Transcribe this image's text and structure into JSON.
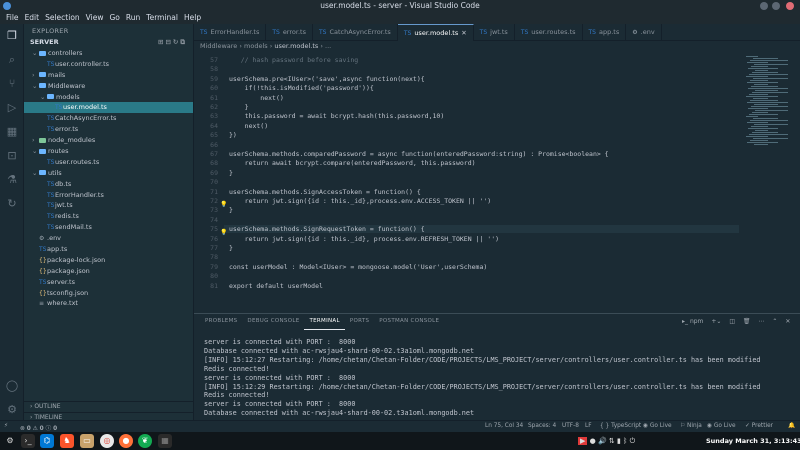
{
  "window": {
    "title": "user.model.ts - server - Visual Studio Code",
    "colors": {
      "close": "#e06c75",
      "min": "#5c6773",
      "max": "#5c6773",
      "accent": "#2a7a88"
    }
  },
  "menu": [
    "File",
    "Edit",
    "Selection",
    "View",
    "Go",
    "Run",
    "Terminal",
    "Help"
  ],
  "activity_icons": [
    "files-icon",
    "search-icon",
    "source-control-icon",
    "run-debug-icon",
    "extensions-icon",
    "remote-icon",
    "testing-icon",
    "docker-icon",
    "live-share-icon",
    "account-icon",
    "settings-icon"
  ],
  "explorer": {
    "header": "EXPLORER",
    "root": "SERVER",
    "tree": [
      {
        "label": "controllers",
        "type": "folder",
        "open": true
      },
      {
        "label": "user.controller.ts",
        "type": "ts"
      },
      {
        "label": "mails",
        "type": "folder",
        "open": false
      },
      {
        "label": "Middleware",
        "type": "folder",
        "open": true
      },
      {
        "label": "models",
        "type": "folder",
        "open": true
      },
      {
        "label": "user.model.ts",
        "type": "ts",
        "selected": true
      },
      {
        "label": "CatchAsyncError.ts",
        "type": "ts"
      },
      {
        "label": "error.ts",
        "type": "ts"
      },
      {
        "label": "node_modules",
        "type": "folder",
        "open": false
      },
      {
        "label": "routes",
        "type": "folder",
        "open": true
      },
      {
        "label": "user.routes.ts",
        "type": "ts"
      },
      {
        "label": "utils",
        "type": "folder",
        "open": true
      },
      {
        "label": "db.ts",
        "type": "ts"
      },
      {
        "label": "ErrorHandler.ts",
        "type": "ts"
      },
      {
        "label": "jwt.ts",
        "type": "ts"
      },
      {
        "label": "redis.ts",
        "type": "ts"
      },
      {
        "label": "sendMail.ts",
        "type": "ts"
      },
      {
        "label": ".env",
        "type": "env"
      },
      {
        "label": "app.ts",
        "type": "ts"
      },
      {
        "label": "package-lock.json",
        "type": "json"
      },
      {
        "label": "package.json",
        "type": "json"
      },
      {
        "label": "server.ts",
        "type": "ts"
      },
      {
        "label": "tsconfig.json",
        "type": "json"
      },
      {
        "label": "where.txt",
        "type": "txt"
      }
    ],
    "outline": "OUTLINE",
    "timeline": "TIMELINE"
  },
  "tabs": [
    {
      "label": "ErrorHandler.ts"
    },
    {
      "label": "error.ts"
    },
    {
      "label": "CatchAsyncError.ts"
    },
    {
      "label": "user.model.ts",
      "active": true
    },
    {
      "label": "jwt.ts"
    },
    {
      "label": "user.routes.ts"
    },
    {
      "label": "app.ts"
    },
    {
      "label": ".env"
    }
  ],
  "breadcrumb": [
    "Middleware",
    "models",
    "user.model.ts",
    "..."
  ],
  "editor": {
    "lines": [
      {
        "n": "57",
        "t": "   // hash password before saving"
      },
      {
        "n": "58",
        "t": ""
      },
      {
        "n": "59",
        "t": "userSchema.pre<IUser>('save',async function(next){"
      },
      {
        "n": "60",
        "t": "    if(!this.isModified('password')){"
      },
      {
        "n": "61",
        "t": "        next()"
      },
      {
        "n": "62",
        "t": "    }"
      },
      {
        "n": "63",
        "t": "    this.password = await bcrypt.hash(this.password,10)"
      },
      {
        "n": "64",
        "t": "    next()"
      },
      {
        "n": "65",
        "t": "})"
      },
      {
        "n": "66",
        "t": ""
      },
      {
        "n": "67",
        "t": "userSchema.methods.comparedPassword = async function(enteredPassword:string) : Promise<boolean> {"
      },
      {
        "n": "68",
        "t": "    return await bcrypt.compare(enteredPassword, this.password)"
      },
      {
        "n": "69",
        "t": "}"
      },
      {
        "n": "70",
        "t": ""
      },
      {
        "n": "71",
        "t": "userSchema.methods.SignAccessToken = function() {"
      },
      {
        "n": "72",
        "t": "    return jwt.sign({id : this._id},process.env.ACCESS_TOKEN || '')"
      },
      {
        "n": "73",
        "t": "}"
      },
      {
        "n": "74",
        "t": ""
      },
      {
        "n": "75",
        "t": "userSchema.methods.SignRequestToken = function() {"
      },
      {
        "n": "76",
        "t": "    return jwt.sign({id : this._id}, process.env.REFRESH_TOKEN || '')"
      },
      {
        "n": "77",
        "t": "}"
      },
      {
        "n": "78",
        "t": ""
      },
      {
        "n": "79",
        "t": "const userModel : Model<IUser> = mongoose.model('User',userSchema)"
      },
      {
        "n": "80",
        "t": ""
      },
      {
        "n": "81",
        "t": "export default userModel"
      }
    ]
  },
  "panel": {
    "tabs": [
      "PROBLEMS",
      "DEBUG CONSOLE",
      "TERMINAL",
      "PORTS",
      "POSTMAN CONSOLE"
    ],
    "active_tab": "TERMINAL",
    "terminal_label": "npm",
    "terminal": [
      "server is connected with PORT :  8000",
      "Database connected with ac-rwsjau4-shard-00-02.t3a1oml.mongodb.net",
      "[INFO] 15:12:27 Restarting: /home/chetan/Chetan-Folder/CODE/PROJECTS/LMS_PROJECT/server/controllers/user.controller.ts has been modified",
      "Redis connected!",
      "server is connected with PORT :  8000",
      "[INFO] 15:12:29 Restarting: /home/chetan/Chetan-Folder/CODE/PROJECTS/LMS_PROJECT/server/controllers/user.controller.ts has been modified",
      "Redis connected!",
      "server is connected with PORT :  8000",
      "Database connected with ac-rwsjau4-shard-00-02.t3a1oml.mongodb.net"
    ]
  },
  "status": {
    "errors": "0",
    "warnings": "0",
    "info": "0",
    "cursor": "Ln 75, Col 34",
    "spaces": "Spaces: 4",
    "encoding": "UTF-8",
    "eol": "LF",
    "language": "TypeScript",
    "golive": "Go Live",
    "ninja": "Ninja",
    "golive2": "Go Live",
    "prettier": "Prettier"
  },
  "taskbar": {
    "datetime": "Sunday March 31, 3:13:43 PM",
    "apps": [
      "app-menu",
      "terminal",
      "vscode",
      "brave",
      "files",
      "chrome",
      "firefox",
      "mongodb-compass",
      "grid-app"
    ]
  }
}
